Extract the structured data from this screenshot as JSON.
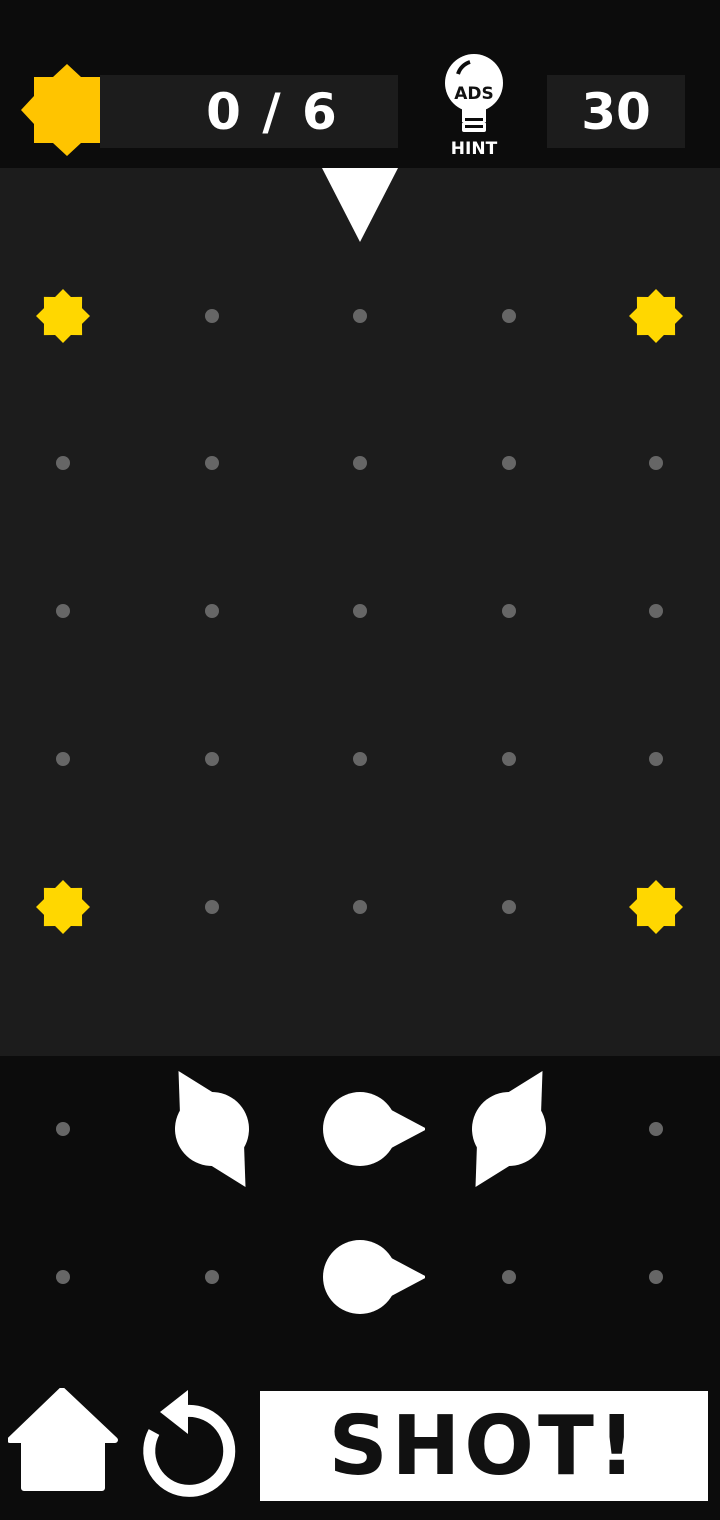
{
  "header": {
    "score_text": "0 / 6",
    "moves": "30",
    "hint_ads_label": "ADS",
    "hint_label": "HINT"
  },
  "board": {
    "rows": 5,
    "cols": 5,
    "stars": [
      [
        0,
        0
      ],
      [
        0,
        4
      ],
      [
        4,
        0
      ],
      [
        4,
        4
      ]
    ],
    "launcher_col": 2
  },
  "tray": {
    "pieces": [
      {
        "row": 0,
        "col": 1,
        "direction": "up-left"
      },
      {
        "row": 0,
        "col": 2,
        "direction": "right"
      },
      {
        "row": 0,
        "col": 3,
        "direction": "up-right"
      },
      {
        "row": 1,
        "col": 2,
        "direction": "right"
      }
    ]
  },
  "footer": {
    "shot_label": "SHOT!"
  },
  "colors": {
    "star": "#FFD700",
    "score_star": "#FFC400",
    "board_bg": "#1c1c1c",
    "dot": "#666666"
  }
}
